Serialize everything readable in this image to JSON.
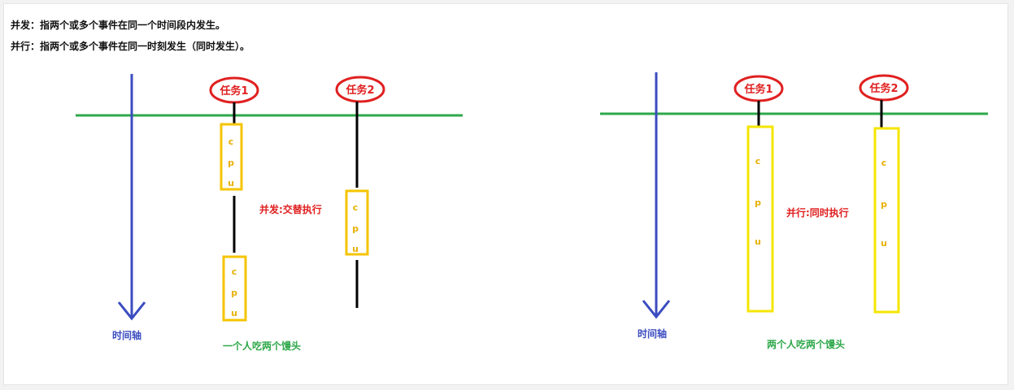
{
  "description": {
    "concurrency": "并发：指两个或多个事件在同一个时间段内发生。",
    "parallelism": "并行：指两个或多个事件在同一时刻发生（同时发生）。"
  },
  "colors": {
    "axis": "#3b4cc0",
    "axis_label": "#3b4cc0",
    "baseline": "#2ea84a",
    "task_ellipse": "#e02020",
    "task_text": "#e02020",
    "cpu_box_left": "#f5c400",
    "cpu_box_right": "#f5e600",
    "cpu_text": "#e8b000",
    "caption": "#2ea84a",
    "mode_label": "#e02020",
    "track": "#000000"
  },
  "left_diagram": {
    "axis_label": "时间轴",
    "task1_label": "任务1",
    "task2_label": "任务2",
    "cpu_letters": [
      "c",
      "p",
      "u"
    ],
    "mode_label": "并发:交替执行",
    "caption": "一个人吃两个馒头"
  },
  "right_diagram": {
    "axis_label": "时间轴",
    "task1_label": "任务1",
    "task2_label": "任务2",
    "cpu_letters": [
      "c",
      "p",
      "u"
    ],
    "mode_label": "并行:同时执行",
    "caption": "两个人吃两个馒头"
  }
}
